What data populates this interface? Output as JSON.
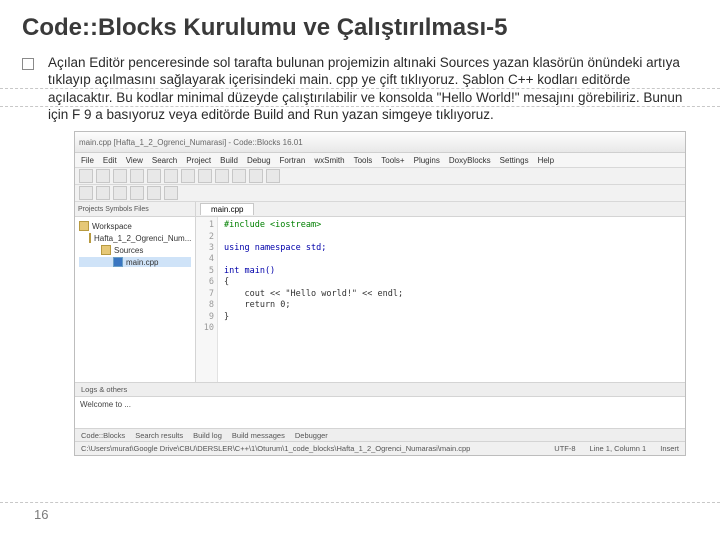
{
  "slide": {
    "title": "Code::Blocks Kurulumu ve Çalıştırılması-5",
    "body": "Açılan Editör penceresinde sol tarafta bulunan projemizin altınaki Sources yazan klasörün önündeki artıya tıklayıp açılmasını sağlayarak içerisindeki main. cpp ye çift tıklıyoruz. Şablon C++ kodları editörde açılacaktır. Bu kodlar minimal düzeyde çalıştırılabilir ve konsolda \"Hello World!\" mesajını görebiliriz. Bunun için F 9 a basıyoruz veya editörde Build and Run yazan simgeye tıklıyoruz.",
    "page_number": "16"
  },
  "ide": {
    "window_title": "main.cpp [Hafta_1_2_Ogrenci_Numarasi] - Code::Blocks 16.01",
    "menu": [
      "File",
      "Edit",
      "View",
      "Search",
      "Project",
      "Build",
      "Debug",
      "Fortran",
      "wxSmith",
      "Tools",
      "Tools+",
      "Plugins",
      "DoxyBlocks",
      "Settings",
      "Help"
    ],
    "side_tabs": "Projects   Symbols   Files",
    "workspace_label": "Workspace",
    "project_label": "Hafta_1_2_Ogrenci_Num...",
    "sources_label": "Sources",
    "main_file_label": "main.cpp",
    "editor_tab": "main.cpp",
    "gutter": [
      "1",
      "2",
      "3",
      "4",
      "5",
      "6",
      "7",
      "8",
      "9",
      "10"
    ],
    "code_lines": {
      "l1": "#include <iostream>",
      "l2": "",
      "l3": "using namespace std;",
      "l4": "",
      "l5": "int main()",
      "l6": "{",
      "l7": "    cout << \"Hello world!\" << endl;",
      "l8": "    return 0;",
      "l9": "}",
      "l10": ""
    },
    "logs_tab": "Logs & others",
    "welcome": "Welcome to ...",
    "bottom_tabs": [
      "Code::Blocks",
      "Search results",
      "Build log",
      "Build messages",
      "Debugger"
    ],
    "status_left": "C:\\Users\\murat\\Google Drive\\CBU\\DERSLER\\C++\\1\\Oturum\\1_code_blocks\\Hafta_1_2_Ogrenci_Numarasi\\main.cpp",
    "status_mid": "UTF-8",
    "status_line": "Line 1, Column 1",
    "status_ins": "Insert"
  }
}
